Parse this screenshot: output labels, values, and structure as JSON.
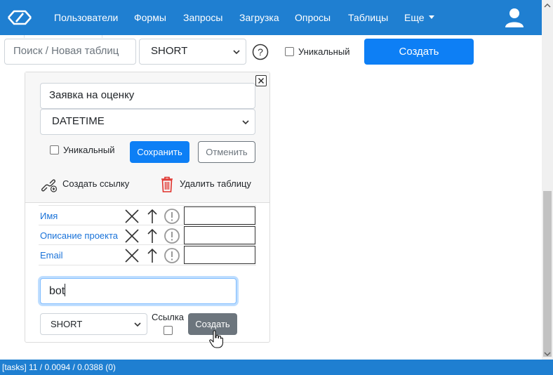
{
  "nav": {
    "items": [
      "Пользователи",
      "Формы",
      "Запросы",
      "Загрузка",
      "Опросы",
      "Таблицы",
      "Еще"
    ],
    "brand_color": "#1f7fd1"
  },
  "toolbar": {
    "search_placeholder": "Поиск / Новая таблиц",
    "type_select": "SHORT",
    "unique_label": "Уникальный",
    "create_label": "Создать"
  },
  "panel": {
    "name_value": "Заявка на оценку",
    "type_select": "DATETIME",
    "unique_label": "Уникальный",
    "save_label": "Сохранить",
    "cancel_label": "Отменить",
    "create_link_label": "Создать ссылку",
    "delete_table_label": "Удалить таблицу",
    "fields": [
      {
        "name": "Имя"
      },
      {
        "name": "Описание проекта"
      },
      {
        "name": "Email"
      }
    ],
    "new_field_value": "bot",
    "new_field_type": "SHORT",
    "link_label": "Ссылка",
    "create_label": "Создать"
  },
  "status": {
    "text": "[tasks] 11 / 0.0094 / 0.0388 (0)"
  },
  "icons": [
    "logo-icon",
    "user-icon",
    "help-icon",
    "close-icon",
    "link-add-icon",
    "trash-icon",
    "delete-x-icon",
    "arrow-up-icon",
    "alert-icon",
    "chevron-down-icon",
    "hand-cursor-icon"
  ]
}
